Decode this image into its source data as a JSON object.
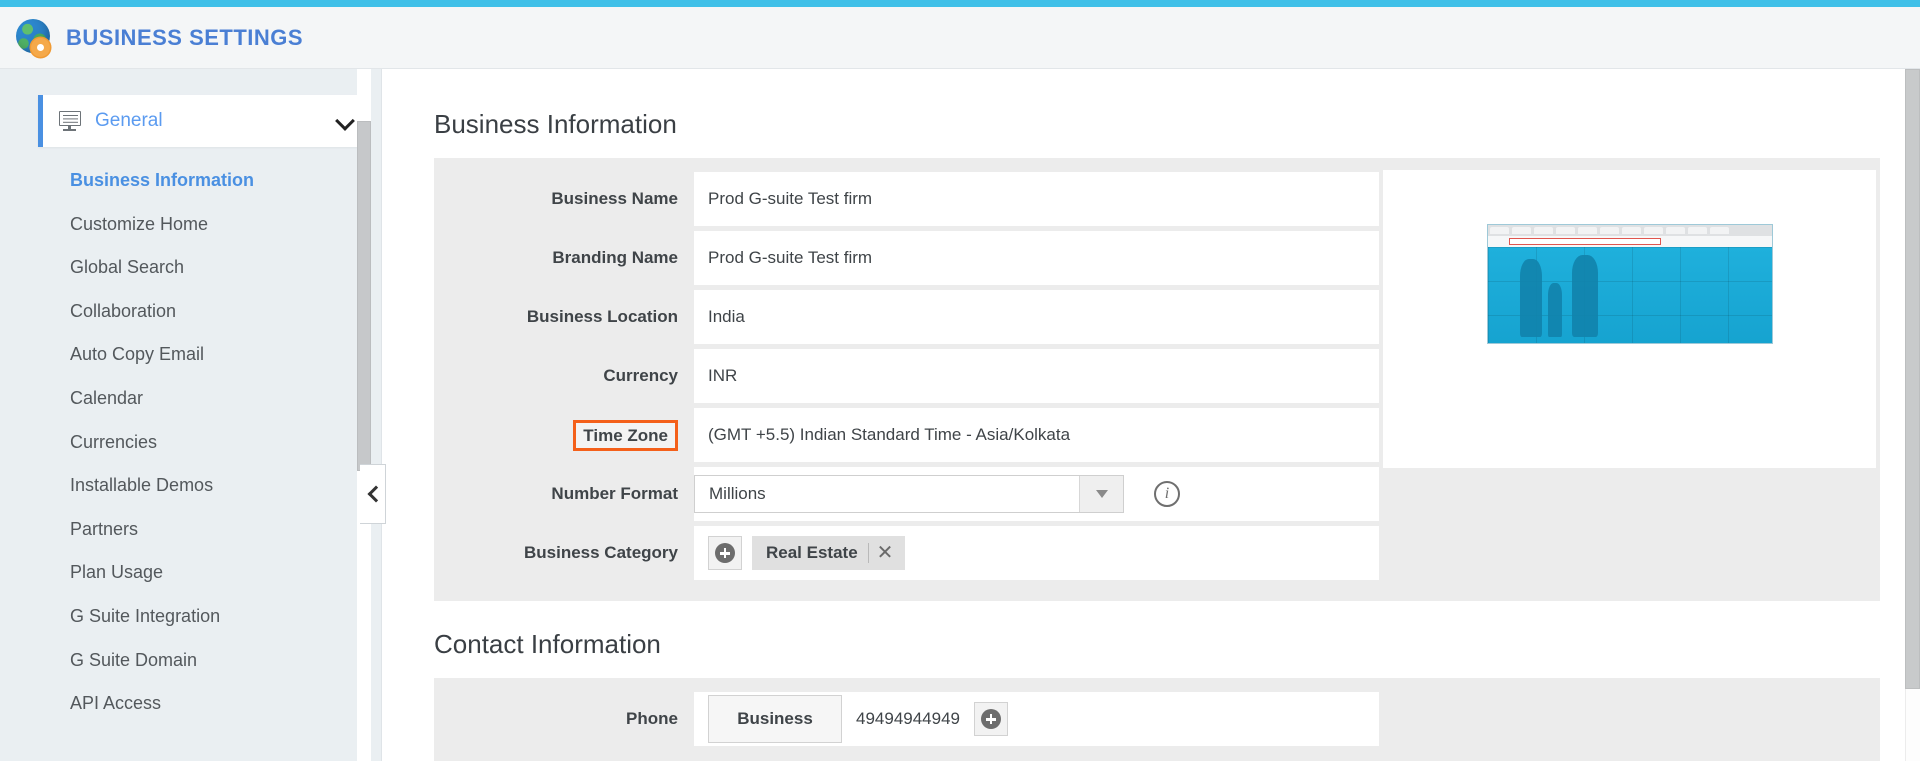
{
  "header": {
    "title": "BUSINESS SETTINGS",
    "logo_icon": "globe-gear-icon",
    "accent_color": "#3fc0e8",
    "title_color": "#4a7fd4"
  },
  "sidebar": {
    "group": {
      "label": "General",
      "icon": "monitor-icon",
      "chevron": "chevron-down-icon"
    },
    "items": [
      {
        "label": "Business Information",
        "active": true
      },
      {
        "label": "Customize Home",
        "active": false
      },
      {
        "label": "Global Search",
        "active": false
      },
      {
        "label": "Collaboration",
        "active": false
      },
      {
        "label": "Auto Copy Email",
        "active": false
      },
      {
        "label": "Calendar",
        "active": false
      },
      {
        "label": "Currencies",
        "active": false
      },
      {
        "label": "Installable Demos",
        "active": false
      },
      {
        "label": "Partners",
        "active": false
      },
      {
        "label": "Plan Usage",
        "active": false
      },
      {
        "label": "G Suite Integration",
        "active": false
      },
      {
        "label": "G Suite Domain",
        "active": false
      },
      {
        "label": "API Access",
        "active": false
      }
    ],
    "collapse_icon": "chevron-left-icon"
  },
  "main": {
    "business_information": {
      "title": "Business Information",
      "fields": [
        {
          "label": "Business Name",
          "value": "Prod G-suite Test firm"
        },
        {
          "label": "Branding Name",
          "value": "Prod G-suite Test firm"
        },
        {
          "label": "Business Location",
          "value": "India"
        },
        {
          "label": "Currency",
          "value": "INR"
        },
        {
          "label": "Time Zone",
          "value": "(GMT +5.5) Indian Standard Time - Asia/Kolkata",
          "highlighted": true,
          "highlight_color": "#f4601a"
        }
      ],
      "number_format": {
        "label": "Number Format",
        "value": "Millions",
        "caret_icon": "chevron-down-icon",
        "info_icon": "info-icon",
        "info_glyph": "i"
      },
      "business_category": {
        "label": "Business Category",
        "add_icon": "plus-circle-icon",
        "chips": [
          {
            "label": "Real Estate",
            "remove_icon": "close-icon",
            "remove_glyph": "✕"
          }
        ]
      },
      "logo_preview": {
        "name": "business-logo-preview",
        "alt": "browser screenshot thumbnail"
      }
    },
    "contact_information": {
      "title": "Contact Information",
      "phone": {
        "label": "Phone",
        "type": "Business",
        "number": "49494944949",
        "add_icon": "plus-circle-icon"
      }
    }
  }
}
